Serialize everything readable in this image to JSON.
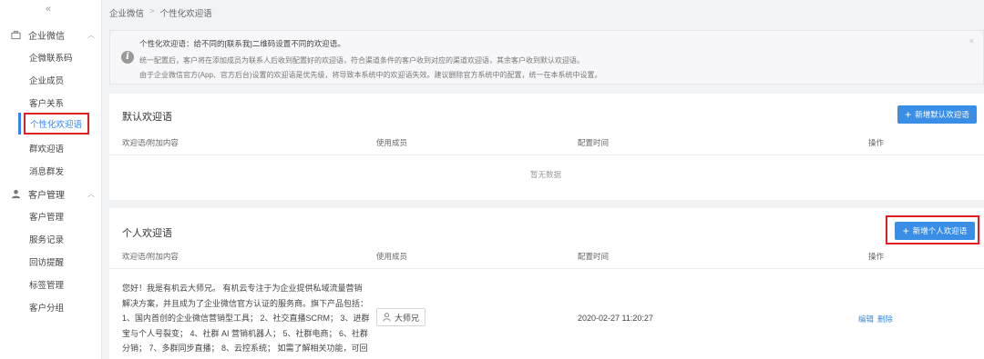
{
  "sidebar": {
    "collapse": "«",
    "groups": [
      {
        "label": "企业微信",
        "items": [
          "企微联系码",
          "企业成员",
          "客户关系",
          "个性化欢迎语",
          "群欢迎语",
          "消息群发"
        ]
      },
      {
        "label": "客户管理",
        "items": [
          "客户管理",
          "服务记录",
          "回访提醒",
          "标签管理",
          "客户分组"
        ]
      }
    ],
    "active_item": "个性化欢迎语"
  },
  "breadcrumb": {
    "root": "企业微信",
    "sep": ">",
    "current": "个性化欢迎语"
  },
  "notice": {
    "title": "个性化欢迎语：给不同的[联系我]二维码设置不同的欢迎语。",
    "line1": "统一配置后，客户将在添加成员为联系人后收到配置好的欢迎语，符合渠道条件的客户收到对应的渠道欢迎语，其余客户收到默认欢迎语。",
    "line2": "由于企业微信官方(App、官方后台)设置的欢迎语是优先级，将导致本系统中的欢迎语失效。建议删除官方系统中的配置，统一在本系统中设置。",
    "close": "×"
  },
  "default_section": {
    "title": "默认欢迎语",
    "add_button": "新增默认欢迎语",
    "columns": [
      "欢迎语/附加内容",
      "使用成员",
      "配置时间",
      "操作"
    ],
    "empty_text": "暂无数据"
  },
  "personal_section": {
    "title": "个人欢迎语",
    "add_button": "新增个人欢迎语",
    "columns": [
      "欢迎语/附加内容",
      "使用成员",
      "配置时间",
      "操作"
    ],
    "rows": [
      {
        "greeting": "您好！我是有机云大师兄。 有机云专注于为企业提供私域流量营销解决方案，并且成为了企业微信官方认证的服务商。旗下产品包括：1、国内首创的企业微信营销型工具； 2、社交直播SCRM； 3、进群宝与个人号裂变； 4、社群 AI 营销机器人； 5、社群电商； 6、社群分销； 7、多群同步直播； 8、云控系统； 如需了解相关功能，可回复对应数字，我将详细为您讲解！ [图片]",
        "member": "大师兄",
        "time": "2020-02-27 11:20:27",
        "actions": [
          "编辑",
          "删除"
        ]
      }
    ]
  },
  "colors": {
    "accent": "#3a8ee6",
    "highlight": "#e02020"
  }
}
